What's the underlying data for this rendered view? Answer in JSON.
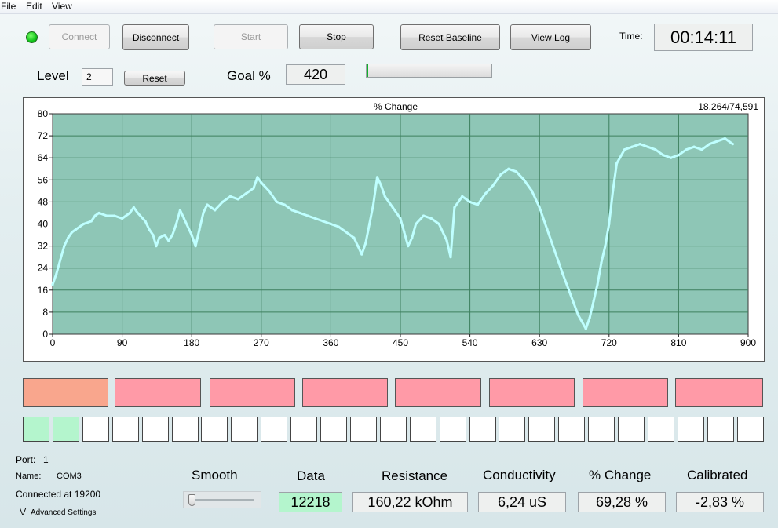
{
  "menu": [
    "File",
    "Edit",
    "View"
  ],
  "toolbar": {
    "connect": "Connect",
    "disconnect": "Disconnect",
    "start": "Start",
    "stop": "Stop",
    "reset_baseline": "Reset Baseline",
    "view_log": "View Log",
    "time_label": "Time:",
    "time_value": "00:14:11",
    "status_color": "#11c41a"
  },
  "level": {
    "label": "Level",
    "value": "2",
    "reset": "Reset"
  },
  "goal": {
    "label": "Goal %",
    "value": "420",
    "progress": 0
  },
  "chart_data": {
    "type": "line",
    "title": "% Change",
    "counter": "18,264/74,591",
    "xlabel": "",
    "ylabel": "",
    "xlim": [
      0,
      900
    ],
    "ylim": [
      0,
      80
    ],
    "xticks": [
      0,
      90,
      180,
      270,
      360,
      450,
      540,
      630,
      720,
      810,
      900
    ],
    "yticks": [
      0,
      8,
      16,
      24,
      32,
      40,
      48,
      56,
      64,
      72,
      80
    ],
    "grid": true,
    "background": "#8ec6b6",
    "line_color": "#bfffff",
    "series": [
      {
        "x": [
          0,
          5,
          10,
          15,
          20,
          25,
          30,
          35,
          40,
          50,
          55,
          60,
          70,
          80,
          90,
          100,
          105,
          110,
          120,
          125,
          130,
          134,
          138,
          145,
          150,
          155,
          160,
          165,
          170,
          180,
          185,
          190,
          195,
          200,
          210,
          220,
          230,
          240,
          250,
          260,
          265,
          270,
          280,
          290,
          300,
          310,
          320,
          330,
          340,
          350,
          360,
          370,
          380,
          390,
          395,
          400,
          405,
          410,
          415,
          420,
          425,
          430,
          440,
          450,
          455,
          460,
          465,
          470,
          480,
          490,
          500,
          510,
          515,
          520,
          530,
          540,
          550,
          560,
          570,
          580,
          590,
          600,
          610,
          620,
          630,
          640,
          660,
          680,
          690,
          695,
          700,
          705,
          710,
          715,
          720,
          725,
          730,
          740,
          750,
          760,
          770,
          780,
          790,
          800,
          810,
          820,
          830,
          840,
          850,
          860,
          870,
          880
        ],
        "y": [
          18,
          22,
          27,
          32,
          35,
          37,
          38,
          39,
          40,
          41,
          43,
          44,
          43,
          43,
          42,
          44,
          46,
          44,
          41,
          38,
          36,
          32,
          35,
          36,
          34,
          36,
          40,
          45,
          42,
          36,
          32,
          38,
          44,
          47,
          45,
          48,
          50,
          49,
          51,
          53,
          57,
          55,
          52,
          48,
          47,
          45,
          44,
          43,
          42,
          41,
          40,
          39,
          37,
          35,
          32,
          29,
          33,
          40,
          47,
          57,
          54,
          50,
          46,
          42,
          37,
          32,
          35,
          40,
          43,
          42,
          40,
          34,
          28,
          46,
          50,
          48,
          47,
          51,
          54,
          58,
          60,
          59,
          56,
          52,
          46,
          38,
          22,
          7,
          2,
          6,
          12,
          18,
          26,
          32,
          40,
          52,
          62,
          67,
          68,
          69,
          68,
          67,
          65,
          64,
          65,
          67,
          68,
          67,
          69,
          70,
          71,
          69
        ]
      }
    ]
  },
  "tiles_row1": [
    {
      "color": "#f9a68d"
    },
    {
      "color": "#ff9aa7"
    },
    {
      "color": "#ff9aa7"
    },
    {
      "color": "#ff9aa7"
    },
    {
      "color": "#ff9aa7"
    },
    {
      "color": "#ff9aa7"
    },
    {
      "color": "#ff9aa7"
    },
    {
      "color": "#ff9aa7"
    }
  ],
  "squares": [
    true,
    true,
    false,
    false,
    false,
    false,
    false,
    false,
    false,
    false,
    false,
    false,
    false,
    false,
    false,
    false,
    false,
    false,
    false,
    false,
    false,
    false,
    false,
    false,
    false
  ],
  "port": {
    "port_label": "Port:",
    "port_value": "1",
    "name_label": "Name:",
    "name_value": "COM3",
    "connected": "Connected at 19200",
    "advanced": "Advanced Settings"
  },
  "smooth": {
    "label": "Smooth",
    "value": 0
  },
  "readouts": {
    "data_label": "Data",
    "data_value": "12218",
    "resistance_label": "Resistance",
    "resistance_value": "160,22 kOhm",
    "conductivity_label": "Conductivity",
    "conductivity_value": "6,24 uS",
    "pct_label": "% Change",
    "pct_value": "69,28 %",
    "calibrated_label": "Calibrated",
    "calibrated_value": "-2,83 %",
    "data_highlight": "#b4f5cd"
  }
}
